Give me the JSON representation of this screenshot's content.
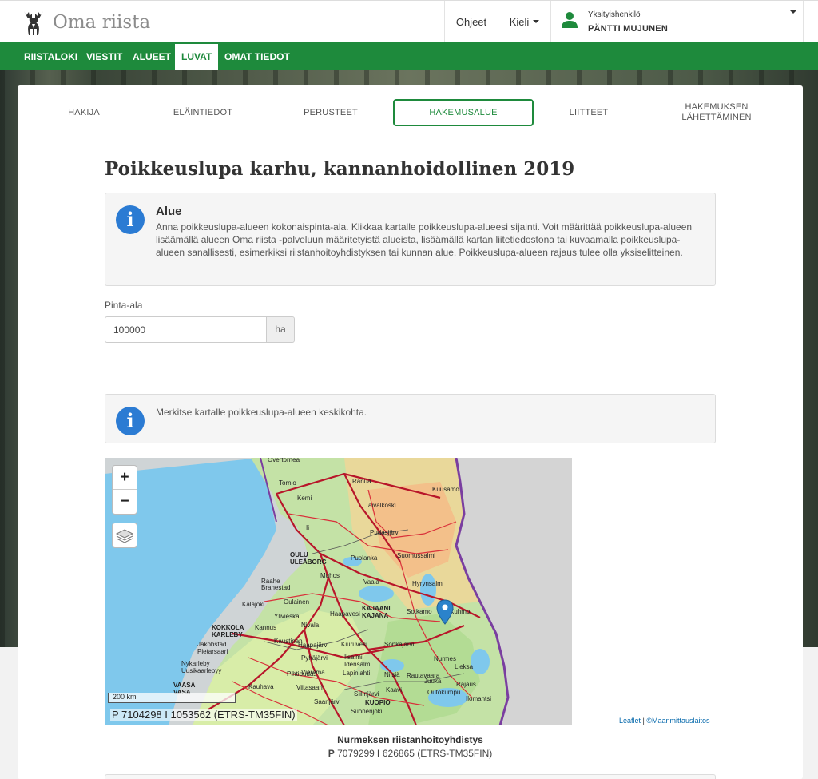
{
  "app": {
    "title": "Oma riista"
  },
  "header": {
    "help": "Ohjeet",
    "language": "Kieli",
    "user_kind": "Yksityishenkilö",
    "user_name": "PÄNTTI MUJUNEN"
  },
  "main_nav": {
    "items": [
      {
        "label": "RIISTALOKI"
      },
      {
        "label": "VIESTIT"
      },
      {
        "label": "ALUEET"
      },
      {
        "label": "LUVAT",
        "active": true
      },
      {
        "label": "OMAT TIEDOT"
      }
    ]
  },
  "steps": [
    {
      "label": "HAKIJA"
    },
    {
      "label": "ELÄINTIEDOT"
    },
    {
      "label": "PERUSTEET"
    },
    {
      "label": "HAKEMUSALUE",
      "active": true
    },
    {
      "label": "LIITTEET"
    },
    {
      "label": "HAKEMUKSEN LÄHETTÄMINEN"
    }
  ],
  "page": {
    "title": "Poikkeuslupa karhu, kannanhoidollinen 2019",
    "info1": {
      "title": "Alue",
      "text": "Anna poikkeuslupa-alueen kokonaispinta-ala. Klikkaa kartalle poikkeuslupa-alueesi sijainti. Voit määrittää poikkeuslupa-alueen lisäämällä alueen Oma riista -palveluun määritetyistä alueista, lisäämällä kartan liitetiedostona tai kuvaamalla poikkeuslupa-alueen sanallisesti, esimerkiksi riistanhoitoyhdistyksen tai kunnan alue. Poikkeuslupa-alueen rajaus tulee olla yksiselitteinen."
    },
    "area_field": {
      "label": "Pinta-ala",
      "value": "100000",
      "unit": "ha"
    },
    "info2": {
      "text": "Merkitse kartalle poikkeuslupa-alueen keskikohta."
    }
  },
  "map": {
    "zoom_in": "+",
    "zoom_out": "−",
    "scale_label": "200 km",
    "coords_readout": "P 7104298 I 1053562 (ETRS-TM35FIN)",
    "attribution_leaflet": "Leaflet",
    "attribution_sep": " | ",
    "attribution_mml": "©Maanmittauslaitos",
    "places": [
      "Overtorneå",
      "Tornio",
      "Kemi",
      "Ranua",
      "Kuusamo",
      "Taivalkoski",
      "Ii",
      "Pudasjärvi",
      "OULU",
      "ULEÅBORG",
      "Muhos",
      "Puolanka",
      "Suomussalmi",
      "Raahe",
      "Brahestad",
      "Vaala",
      "Hyrynsalmi",
      "Kalajoki",
      "Oulainen",
      "Ylivieska",
      "Haapavesi",
      "KAJAANI",
      "KAJANA",
      "Sotkamo",
      "Kuhmo",
      "KOKKOLA",
      "KARLEBY",
      "Kannus",
      "Nivala",
      "Jakobstad",
      "Pietarsaari",
      "Kaustinen",
      "Haapajärvi",
      "Kiuruvesi",
      "Sonkajärvi",
      "Nurmes",
      "Nykarleby",
      "Uusikaarlepyy",
      "Pyhäjärvi",
      "Iisalmi",
      "Idensalmi",
      "Lieksa",
      "VAASA",
      "VASA",
      "Kauhava",
      "Lapinlahti",
      "Nilsiä",
      "Juuka",
      "Vieremä",
      "Pihtipudas",
      "Viitasaari",
      "Siilinjärvi",
      "Kaavi",
      "Rautavaara",
      "KUOPIO",
      "Suonenjoki",
      "Outokumpu",
      "Ilomantsi",
      "Saarijärvi",
      "Rajaus"
    ]
  },
  "selected_place": {
    "name": "Nurmeksen riistanhoitoyhdistys",
    "p_label": "P",
    "p_value": "7079299",
    "i_label": "I",
    "i_value": "626865 (ETRS-TM35FIN)"
  },
  "colors": {
    "brand_green": "#1e8a3c",
    "info_blue": "#2b7bd3",
    "marker_blue": "#2b83cb"
  }
}
